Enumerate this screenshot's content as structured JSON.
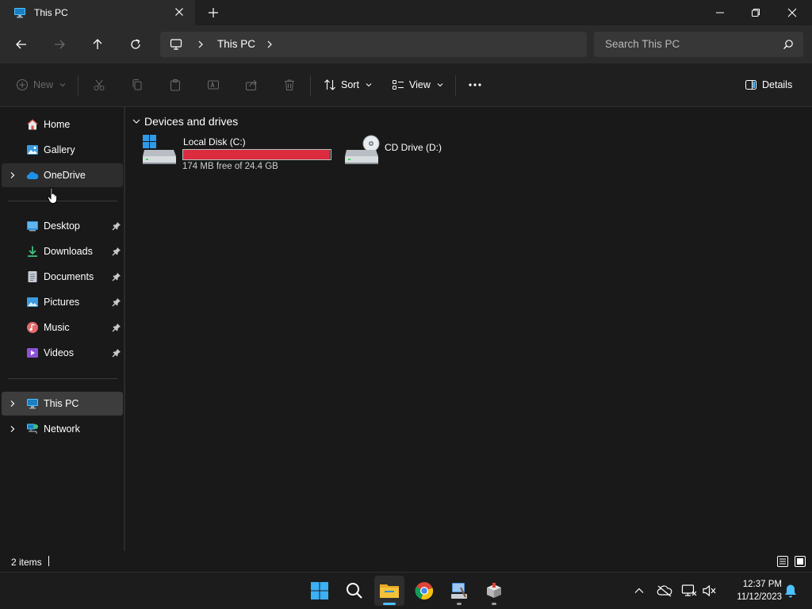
{
  "window": {
    "tab_title": "This PC",
    "tab_icon": "this-pc-icon",
    "new_tab_icon": "plus-icon",
    "controls": [
      "minimize-icon",
      "restore-icon",
      "close-icon"
    ]
  },
  "address_bar": {
    "nav_icons": [
      "back-arrow-icon",
      "forward-arrow-icon",
      "up-arrow-icon",
      "refresh-icon"
    ],
    "breadcrumb": [
      "This PC"
    ],
    "search_placeholder": "Search This PC"
  },
  "command_bar": {
    "new_label": "New",
    "disabled_icons": [
      "cut-icon",
      "copy-icon",
      "paste-icon",
      "rename-icon",
      "share-icon",
      "delete-icon"
    ],
    "sort_label": "Sort",
    "view_label": "View",
    "more_icon": "more-ellipsis-icon",
    "details_label": "Details"
  },
  "sidebar": {
    "top_items": [
      {
        "label": "Home",
        "icon": "home-icon",
        "expandable": false
      },
      {
        "label": "Gallery",
        "icon": "gallery-icon",
        "expandable": false
      },
      {
        "label": "OneDrive",
        "icon": "onedrive-cloud-icon",
        "expandable": true,
        "state": "hover"
      }
    ],
    "quick_access": [
      {
        "label": "Desktop",
        "icon": "desktop-folder-icon",
        "pinned": true
      },
      {
        "label": "Downloads",
        "icon": "downloads-icon",
        "pinned": true
      },
      {
        "label": "Documents",
        "icon": "documents-icon",
        "pinned": true
      },
      {
        "label": "Pictures",
        "icon": "pictures-icon",
        "pinned": true
      },
      {
        "label": "Music",
        "icon": "music-icon",
        "pinned": true
      },
      {
        "label": "Videos",
        "icon": "videos-icon",
        "pinned": true
      }
    ],
    "bottom_items": [
      {
        "label": "This PC",
        "icon": "this-pc-icon",
        "expandable": true,
        "state": "selected"
      },
      {
        "label": "Network",
        "icon": "network-icon",
        "expandable": true
      }
    ]
  },
  "content": {
    "group_title": "Devices and drives",
    "drives": [
      {
        "name": "Local Disk (C:)",
        "icon": "local-disk-icon",
        "free": "174 MB free of 24.4 GB",
        "used_fraction": 0.993,
        "bar_color": "#da2b3f"
      },
      {
        "name": "CD Drive (D:)",
        "icon": "cd-drive-icon"
      }
    ]
  },
  "status_bar": {
    "item_count": "2 items",
    "view_icons": [
      "details-view-icon",
      "large-icons-view-icon"
    ]
  },
  "taskbar": {
    "apps": [
      "start-icon",
      "search-icon",
      "file-explorer-icon",
      "chrome-icon",
      "control-panel-icon",
      "installer-icon"
    ],
    "active_app": "file-explorer-icon",
    "tray_icons": [
      "chevron-up-icon",
      "onedrive-offline-icon",
      "network-display-icon",
      "volume-muted-icon",
      "notification-bell-icon"
    ],
    "time": "12:37 PM",
    "date": "11/12/2023"
  },
  "colors": {
    "accent": "#4cc2ff",
    "folder_yellow": "#f3c13a",
    "disk_bar_red": "#da2b3f"
  }
}
